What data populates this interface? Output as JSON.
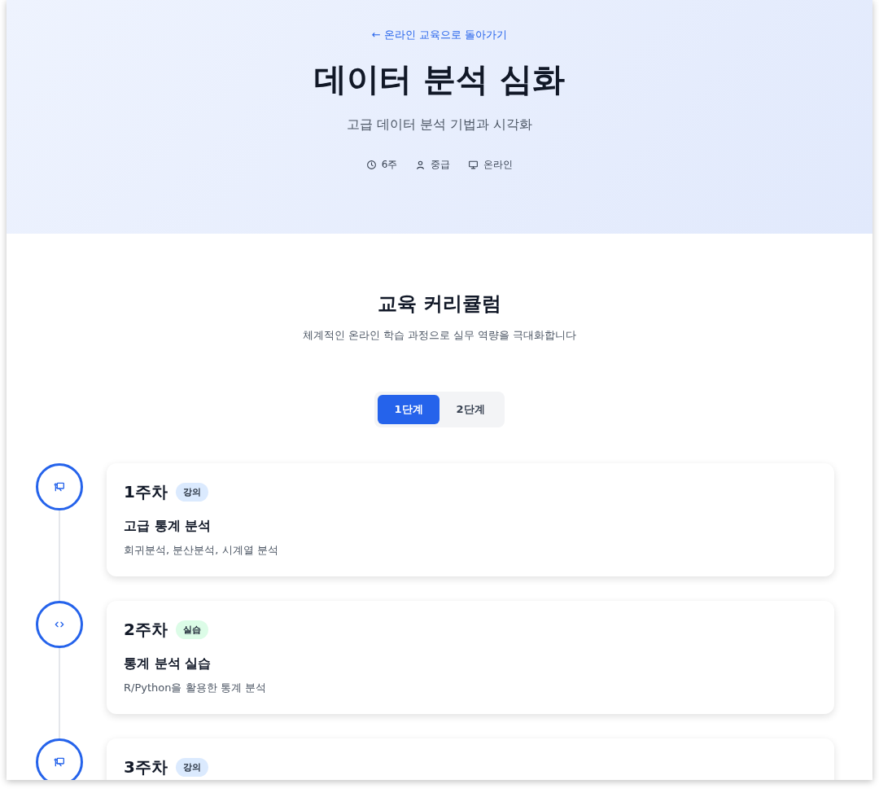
{
  "hero": {
    "back_link": "← 온라인 교육으로 돌아가기",
    "title": "데이터 분석 심화",
    "subtitle": "고급 데이터 분석 기법과 시각화",
    "meta": [
      {
        "kind": "duration",
        "text": "6주"
      },
      {
        "kind": "level",
        "text": "중급"
      },
      {
        "kind": "mode",
        "text": "온라인"
      }
    ]
  },
  "curriculum": {
    "title": "교육 커리큘럼",
    "subtitle": "체계적인 온라인 학습 과정으로 실무 역량을 극대화합니다",
    "tabs": [
      {
        "label": "1단계",
        "selected": true
      },
      {
        "label": "2단계",
        "selected": false
      }
    ],
    "weeks": [
      {
        "week": "1주차",
        "kind": "lecture",
        "badge": "강의",
        "title": "고급 통계 분석",
        "description": "회귀분석, 분산분석, 시계열 분석"
      },
      {
        "week": "2주차",
        "kind": "practice",
        "badge": "실습",
        "title": "통계 분석 실습",
        "description": "R/Python을 활용한 통계 분석"
      },
      {
        "week": "3주차",
        "kind": "lecture",
        "badge": "강의"
      }
    ]
  }
}
